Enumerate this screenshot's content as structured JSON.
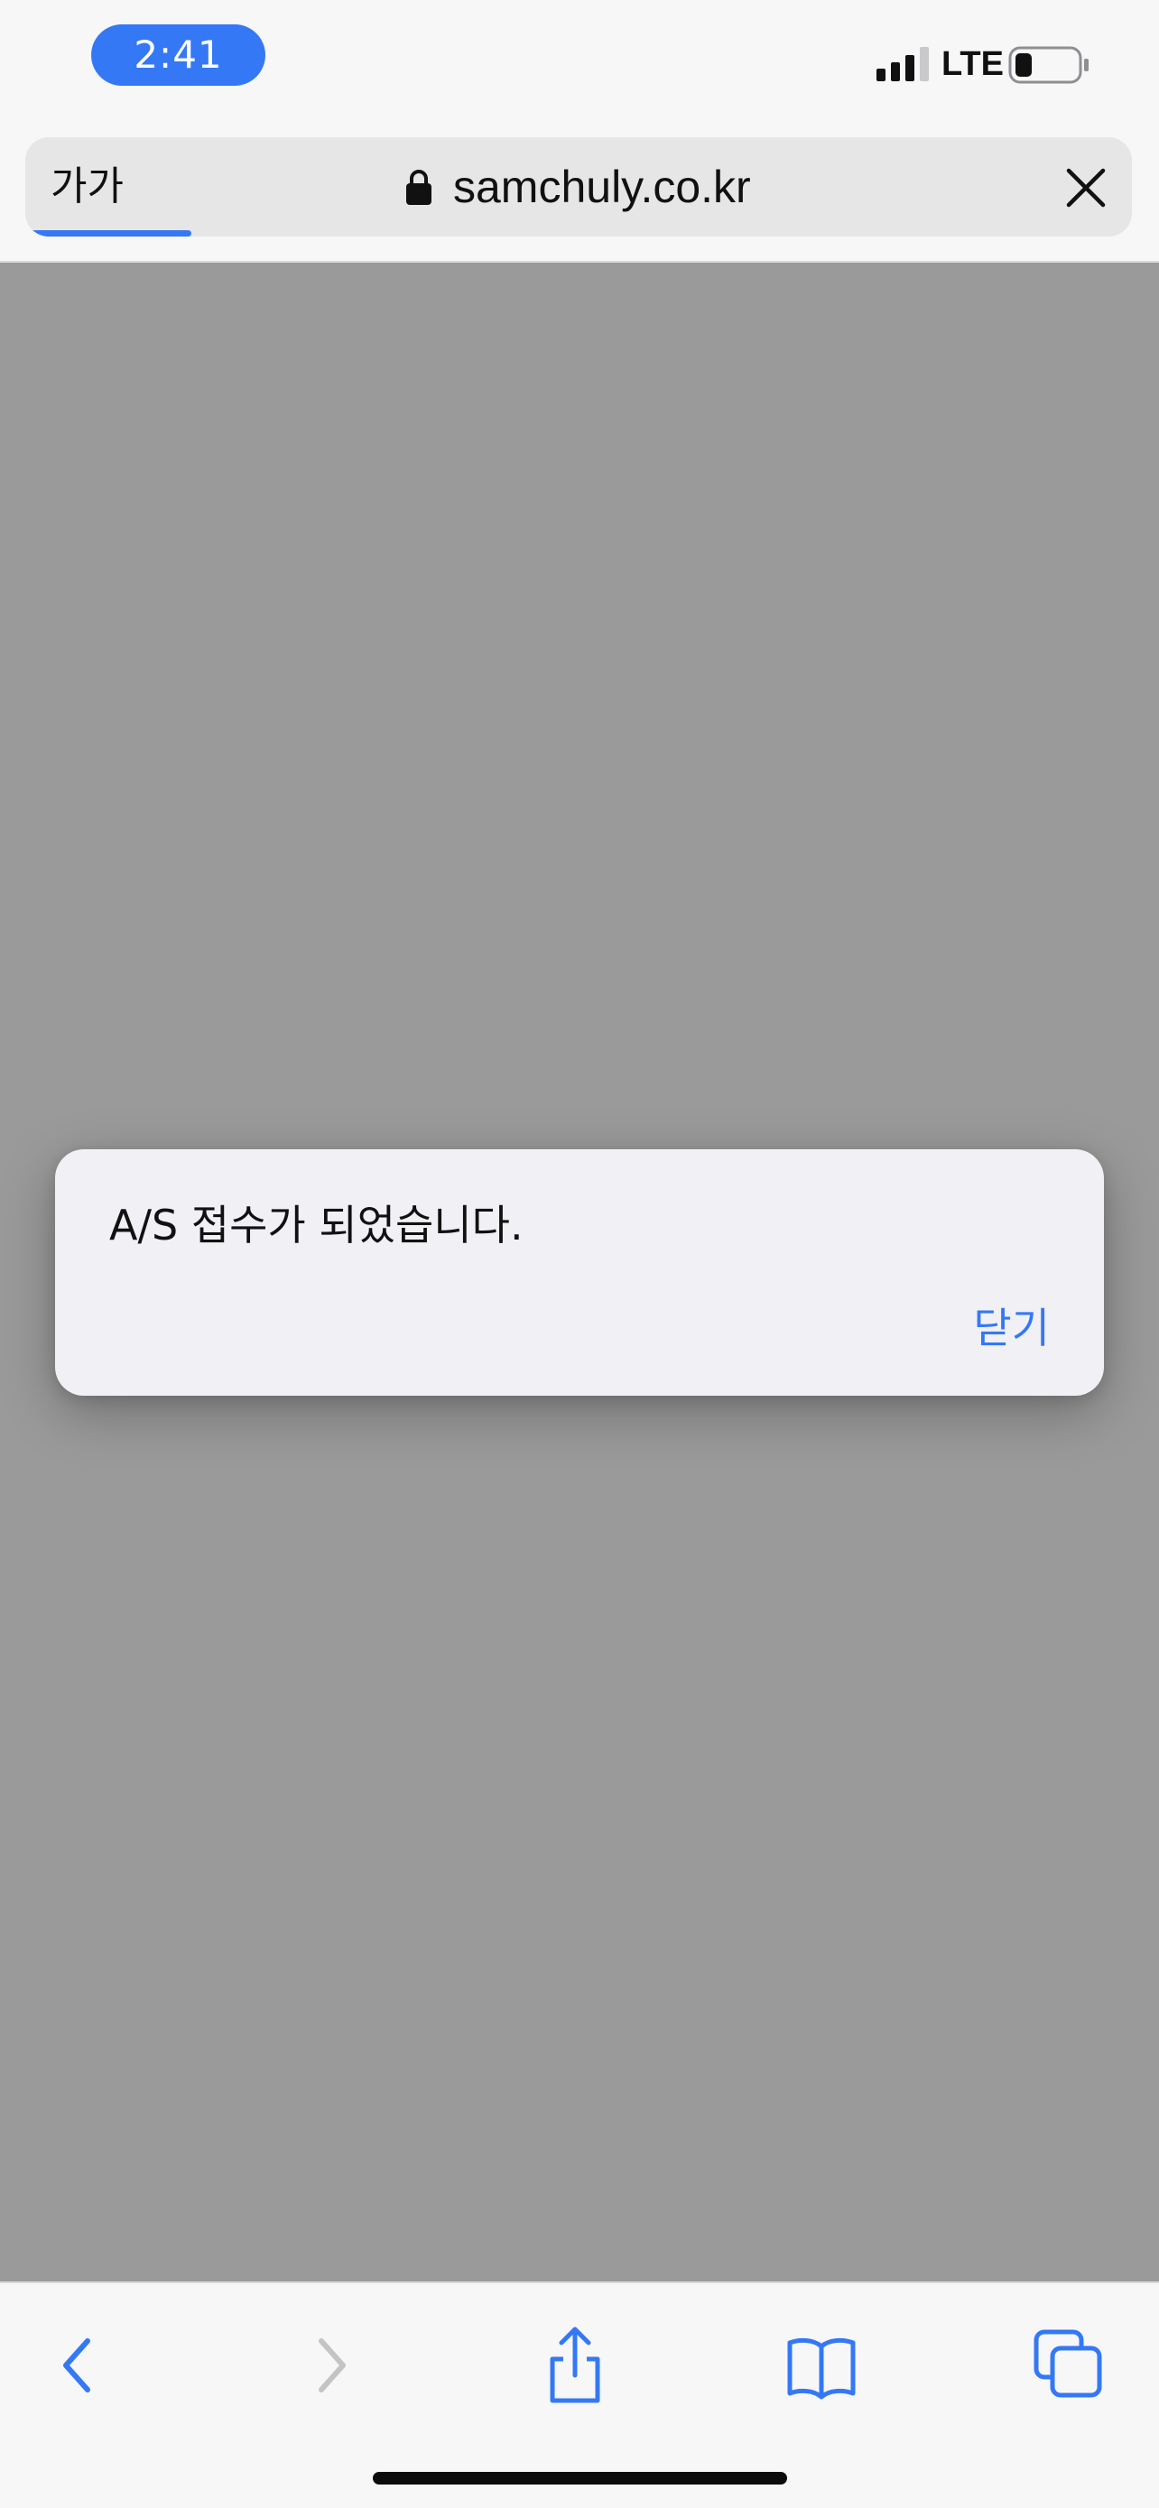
{
  "status_bar": {
    "time": "2:41",
    "network": "LTE",
    "battery_level": 0.2,
    "signal_bars_active": 3
  },
  "address_bar": {
    "text_size_label": "가가",
    "url": "samchuly.co.kr",
    "load_progress": 0.15
  },
  "alert": {
    "message": "A/S 접수가 되었습니다.",
    "close_label": "닫기"
  },
  "toolbar": {
    "items": [
      "back-icon",
      "forward-icon",
      "share-icon",
      "bookmarks-icon",
      "tabs-icon"
    ]
  },
  "colors": {
    "accent": "#3478f6",
    "overlay": "#9a9a9a",
    "alert_background": "#f1f0f5",
    "disabled": "#c4c4c7"
  }
}
